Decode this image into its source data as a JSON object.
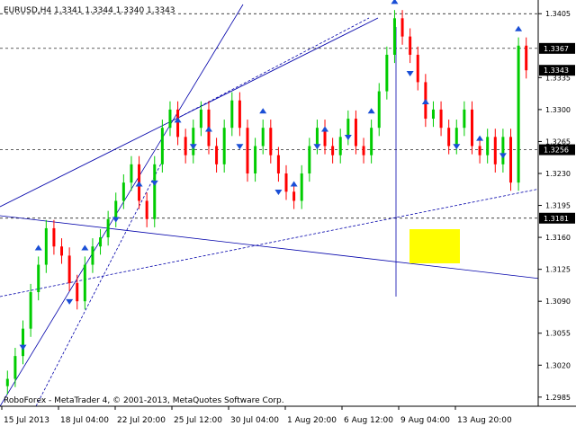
{
  "header": {
    "symbol_line": "EURUSD,H4  1.3341  1.3344  1.3340  1.3343"
  },
  "watermark": "RoboForex - MetaTrader 4, © 2001-2013, MetaQuotes Software Corp.",
  "colors": {
    "bull": "#00cc00",
    "bear": "#ff0000",
    "line": "#0000aa",
    "text": "#000000",
    "highlight": "#ffff00",
    "marker": "#1a4fd6"
  },
  "chart_data": {
    "type": "candlestick",
    "symbol": "EURUSD",
    "timeframe": "H4",
    "last_bar": {
      "open": 1.3341,
      "high": 1.3344,
      "low": 1.334,
      "close": 1.3343
    },
    "ylim": [
      1.2975,
      1.342
    ],
    "yticks": [
      "1.3405",
      "1.3335",
      "1.3300",
      "1.3265",
      "1.3230",
      "1.3195",
      "1.3160",
      "1.3125",
      "1.3090",
      "1.3055",
      "1.3020",
      "1.2985"
    ],
    "price_labels": [
      {
        "label": "1.3367",
        "value": 1.3367
      },
      {
        "label": "1.3343",
        "value": 1.3343
      },
      {
        "label": "1.3256",
        "value": 1.3256
      },
      {
        "label": "1.3181",
        "value": 1.3181
      }
    ],
    "horizontal_levels": [
      1.3405,
      1.3367,
      1.3256,
      1.3181
    ],
    "xticks": [
      "15 Jul 2013",
      "18 Jul 04:00",
      "22 Jul 20:00",
      "25 Jul 12:00",
      "30 Jul 04:00",
      "1 Aug 20:00",
      "6 Aug 12:00",
      "9 Aug 04:00",
      "13 Aug 20:00"
    ],
    "series": [
      {
        "name": "close",
        "values": [
          1.3005,
          1.303,
          1.306,
          1.31,
          1.313,
          1.317,
          1.315,
          1.314,
          1.311,
          1.309,
          1.313,
          1.315,
          1.316,
          1.318,
          1.32,
          1.322,
          1.324,
          1.32,
          1.318,
          1.324,
          1.328,
          1.33,
          1.327,
          1.325,
          1.328,
          1.33,
          1.326,
          1.324,
          1.328,
          1.331,
          1.328,
          1.323,
          1.326,
          1.328,
          1.325,
          1.323,
          1.321,
          1.32,
          1.323,
          1.326,
          1.328,
          1.326,
          1.325,
          1.327,
          1.329,
          1.326,
          1.325,
          1.328,
          1.332,
          1.336,
          1.34,
          1.338,
          1.336,
          1.333,
          1.329,
          1.33,
          1.328,
          1.326,
          1.328,
          1.33,
          1.326,
          1.325,
          1.327,
          1.324,
          1.327,
          1.322,
          1.337,
          1.3343
        ]
      }
    ],
    "markers": {
      "fractal_up": [
        4,
        10,
        17,
        22,
        26,
        33,
        37,
        41,
        47,
        50,
        54,
        61,
        66
      ],
      "fractal_down": [
        2,
        8,
        14,
        19,
        24,
        30,
        35,
        40,
        44,
        52,
        58,
        64
      ]
    }
  }
}
